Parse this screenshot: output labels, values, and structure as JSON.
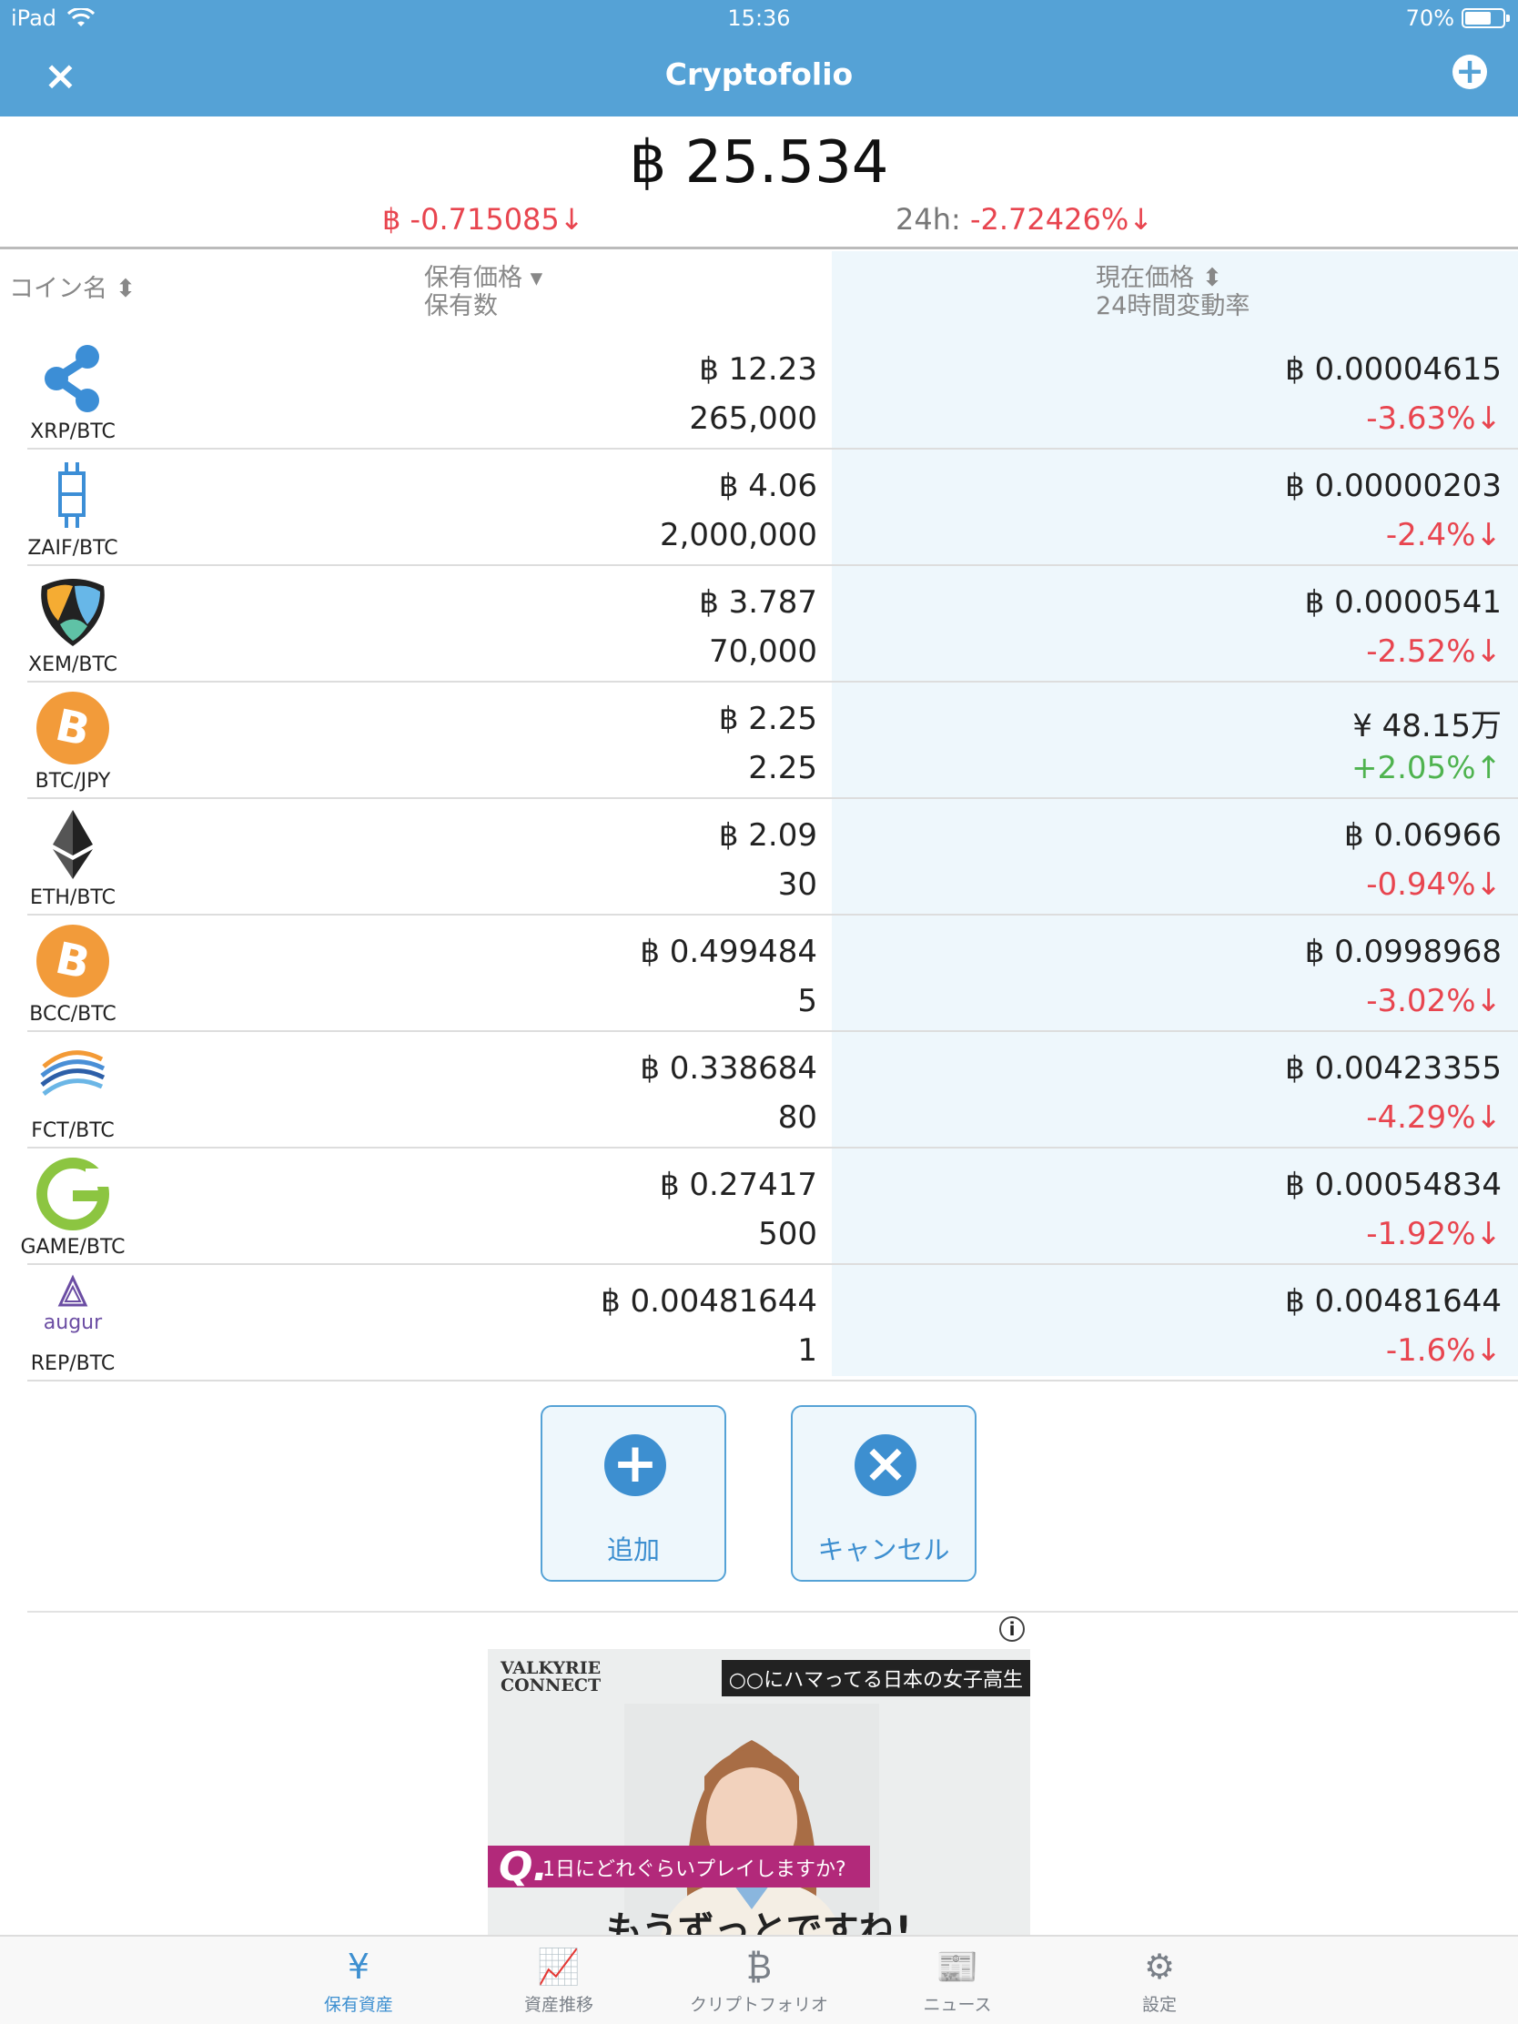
{
  "status": {
    "device": "iPad",
    "time": "15:36",
    "battery": "70%",
    "battery_level": 0.7
  },
  "nav": {
    "title": "Cryptofolio",
    "close_icon": "×",
    "add_icon": "+"
  },
  "summary": {
    "total": "฿ 25.534",
    "change": "฿ -0.715085",
    "change_arrow": "↓",
    "h24_label": "24h:",
    "h24_value": "-2.72426%",
    "h24_arrow": "↓"
  },
  "header": {
    "coin_name": "コイン名 ⬍",
    "holding_price": "保有価格 ▾",
    "holding_qty": "保有数",
    "current_price": "現在価格 ⬍",
    "change_24h": "24時間変動率"
  },
  "rows": [
    {
      "pair": "XRP/BTC",
      "holding": "฿ 12.23",
      "qty": "265,000",
      "price": "฿ 0.00004615",
      "pct": "-3.63%",
      "arrow": "↓",
      "dir": "neg",
      "icon": "ripple-icon"
    },
    {
      "pair": "ZAIF/BTC",
      "holding": "฿ 4.06",
      "qty": "2,000,000",
      "price": "฿ 0.00000203",
      "pct": "-2.4%",
      "arrow": "↓",
      "dir": "neg",
      "icon": "zaif-icon"
    },
    {
      "pair": "XEM/BTC",
      "holding": "฿ 3.787",
      "qty": "70,000",
      "price": "฿ 0.0000541",
      "pct": "-2.52%",
      "arrow": "↓",
      "dir": "neg",
      "icon": "nem-icon"
    },
    {
      "pair": "BTC/JPY",
      "holding": "฿ 2.25",
      "qty": "2.25",
      "price": "¥ 48.15万",
      "pct": "+2.05%",
      "arrow": "↑",
      "dir": "pos",
      "icon": "bitcoin-icon"
    },
    {
      "pair": "ETH/BTC",
      "holding": "฿ 2.09",
      "qty": "30",
      "price": "฿ 0.06966",
      "pct": "-0.94%",
      "arrow": "↓",
      "dir": "neg",
      "icon": "ethereum-icon"
    },
    {
      "pair": "BCC/BTC",
      "holding": "฿ 0.499484",
      "qty": "5",
      "price": "฿ 0.0998968",
      "pct": "-3.02%",
      "arrow": "↓",
      "dir": "neg",
      "icon": "bitcoin-cash-icon"
    },
    {
      "pair": "FCT/BTC",
      "holding": "฿ 0.338684",
      "qty": "80",
      "price": "฿ 0.00423355",
      "pct": "-4.29%",
      "arrow": "↓",
      "dir": "neg",
      "icon": "factom-icon"
    },
    {
      "pair": "GAME/BTC",
      "holding": "฿ 0.27417",
      "qty": "500",
      "price": "฿ 0.00054834",
      "pct": "-1.92%",
      "arrow": "↓",
      "dir": "neg",
      "icon": "gamecredits-icon"
    },
    {
      "pair": "REP/BTC",
      "holding": "฿ 0.00481644",
      "qty": "1",
      "price": "฿ 0.00481644",
      "pct": "-1.6%",
      "arrow": "↓",
      "dir": "neg",
      "icon": "augur-icon",
      "icon_text": "augur"
    }
  ],
  "actions": {
    "add_label": "追加",
    "add_icon": "+",
    "cancel_label": "キャンセル",
    "cancel_icon": "×"
  },
  "ad": {
    "info": "i",
    "logo_line1": "VALKYRIE",
    "logo_line2": "CONNECT",
    "caption": "○○にハマってる日本の女子高生",
    "question_mark": "Q.",
    "question": "1日にどれぐらいプレイしますか?",
    "answer": "もうずっとですね!"
  },
  "tabs": [
    {
      "label": "保有資産",
      "glyph": "¥",
      "icon": "yen-icon",
      "active": true
    },
    {
      "label": "資産推移",
      "glyph": "📈",
      "icon": "chart-icon",
      "active": false
    },
    {
      "label": "クリプトフォリオ",
      "glyph": "₿",
      "icon": "bitcoin-outline-icon",
      "active": false
    },
    {
      "label": "ニュース",
      "glyph": "📰",
      "icon": "newspaper-icon",
      "active": false
    },
    {
      "label": "設定",
      "glyph": "⚙",
      "icon": "gears-icon",
      "active": false
    }
  ],
  "colors": {
    "header_blue": "#55a2d6",
    "accent": "#3d8fd0",
    "negative": "#e8454f",
    "positive": "#4fb34f",
    "column_bg": "#eef7fc"
  }
}
